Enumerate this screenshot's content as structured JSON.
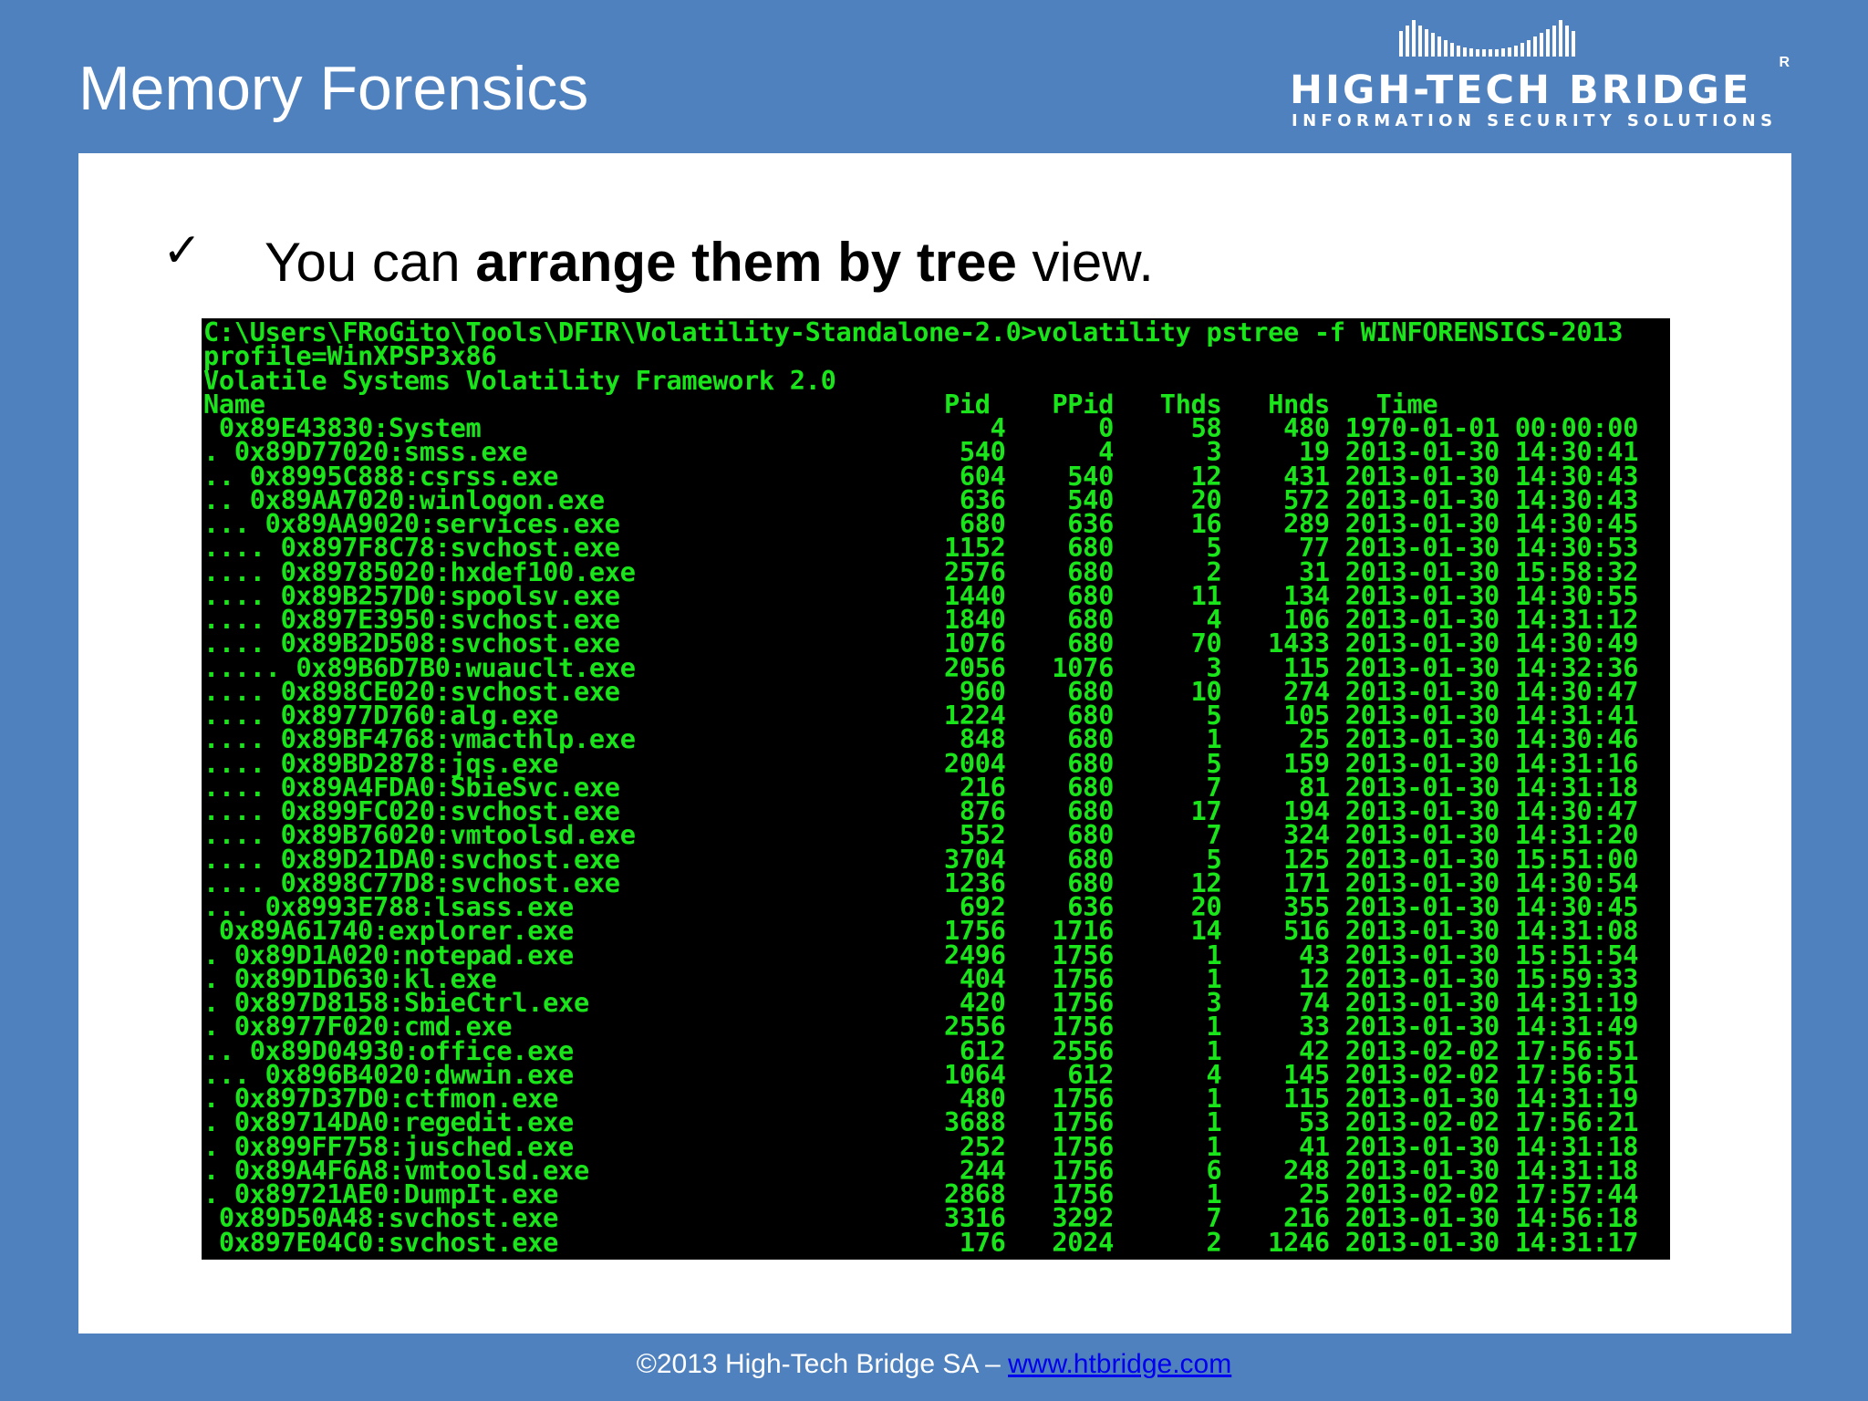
{
  "slide": {
    "title": "Memory Forensics",
    "bullet": {
      "check": "✓",
      "prefix": "You can ",
      "bold": "arrange them by tree",
      "suffix": " view."
    }
  },
  "logo": {
    "name": "HIGH-TECH BRIDGE",
    "registered": "R",
    "tagline": "INFORMATION SECURITY SOLUTIONS"
  },
  "terminal": {
    "command": [
      "C:\\Users\\FRoGito\\Tools\\DFIR\\Volatility-Standalone-2.0>volatility pstree -f WINFORENSICS-2013",
      "profile=WinXPSP3x86",
      "Volatile Systems Volatility Framework 2.0"
    ],
    "columns": [
      "Name",
      "Pid",
      "PPid",
      "Thds",
      "Hnds",
      "Time"
    ],
    "rows": [
      [
        "",
        "0x89E43830:System",
        "4",
        "0",
        "58",
        "480",
        "1970-01-01 00:00:00"
      ],
      [
        ".",
        "0x89D77020:smss.exe",
        "540",
        "4",
        "3",
        "19",
        "2013-01-30 14:30:41"
      ],
      [
        "..",
        "0x8995C888:csrss.exe",
        "604",
        "540",
        "12",
        "431",
        "2013-01-30 14:30:43"
      ],
      [
        "..",
        "0x89AA7020:winlogon.exe",
        "636",
        "540",
        "20",
        "572",
        "2013-01-30 14:30:43"
      ],
      [
        "...",
        "0x89AA9020:services.exe",
        "680",
        "636",
        "16",
        "289",
        "2013-01-30 14:30:45"
      ],
      [
        "....",
        "0x897F8C78:svchost.exe",
        "1152",
        "680",
        "5",
        "77",
        "2013-01-30 14:30:53"
      ],
      [
        "....",
        "0x89785020:hxdef100.exe",
        "2576",
        "680",
        "2",
        "31",
        "2013-01-30 15:58:32"
      ],
      [
        "....",
        "0x89B257D0:spoolsv.exe",
        "1440",
        "680",
        "11",
        "134",
        "2013-01-30 14:30:55"
      ],
      [
        "....",
        "0x897E3950:svchost.exe",
        "1840",
        "680",
        "4",
        "106",
        "2013-01-30 14:31:12"
      ],
      [
        "....",
        "0x89B2D508:svchost.exe",
        "1076",
        "680",
        "70",
        "1433",
        "2013-01-30 14:30:49"
      ],
      [
        ".....",
        "0x89B6D7B0:wuauclt.exe",
        "2056",
        "1076",
        "3",
        "115",
        "2013-01-30 14:32:36"
      ],
      [
        "....",
        "0x898CE020:svchost.exe",
        "960",
        "680",
        "10",
        "274",
        "2013-01-30 14:30:47"
      ],
      [
        "....",
        "0x8977D760:alg.exe",
        "1224",
        "680",
        "5",
        "105",
        "2013-01-30 14:31:41"
      ],
      [
        "....",
        "0x89BF4768:vmacthlp.exe",
        "848",
        "680",
        "1",
        "25",
        "2013-01-30 14:30:46"
      ],
      [
        "....",
        "0x89BD2878:jqs.exe",
        "2004",
        "680",
        "5",
        "159",
        "2013-01-30 14:31:16"
      ],
      [
        "....",
        "0x89A4FDA0:SbieSvc.exe",
        "216",
        "680",
        "7",
        "81",
        "2013-01-30 14:31:18"
      ],
      [
        "....",
        "0x899FC020:svchost.exe",
        "876",
        "680",
        "17",
        "194",
        "2013-01-30 14:30:47"
      ],
      [
        "....",
        "0x89B76020:vmtoolsd.exe",
        "552",
        "680",
        "7",
        "324",
        "2013-01-30 14:31:20"
      ],
      [
        "....",
        "0x89D21DA0:svchost.exe",
        "3704",
        "680",
        "5",
        "125",
        "2013-01-30 15:51:00"
      ],
      [
        "....",
        "0x898C77D8:svchost.exe",
        "1236",
        "680",
        "12",
        "171",
        "2013-01-30 14:30:54"
      ],
      [
        "...",
        "0x8993E788:lsass.exe",
        "692",
        "636",
        "20",
        "355",
        "2013-01-30 14:30:45"
      ],
      [
        "",
        "0x89A61740:explorer.exe",
        "1756",
        "1716",
        "14",
        "516",
        "2013-01-30 14:31:08"
      ],
      [
        ".",
        "0x89D1A020:notepad.exe",
        "2496",
        "1756",
        "1",
        "43",
        "2013-01-30 15:51:54"
      ],
      [
        ".",
        "0x89D1D630:kl.exe",
        "404",
        "1756",
        "1",
        "12",
        "2013-01-30 15:59:33"
      ],
      [
        ".",
        "0x897D8158:SbieCtrl.exe",
        "420",
        "1756",
        "3",
        "74",
        "2013-01-30 14:31:19"
      ],
      [
        ".",
        "0x8977F020:cmd.exe",
        "2556",
        "1756",
        "1",
        "33",
        "2013-01-30 14:31:49"
      ],
      [
        "..",
        "0x89D04930:office.exe",
        "612",
        "2556",
        "1",
        "42",
        "2013-02-02 17:56:51"
      ],
      [
        "...",
        "0x896B4020:dwwin.exe",
        "1064",
        "612",
        "4",
        "145",
        "2013-02-02 17:56:51"
      ],
      [
        ".",
        "0x897D37D0:ctfmon.exe",
        "480",
        "1756",
        "1",
        "115",
        "2013-01-30 14:31:19"
      ],
      [
        ".",
        "0x89714DA0:regedit.exe",
        "3688",
        "1756",
        "1",
        "53",
        "2013-02-02 17:56:21"
      ],
      [
        ".",
        "0x899FF758:jusched.exe",
        "252",
        "1756",
        "1",
        "41",
        "2013-01-30 14:31:18"
      ],
      [
        ".",
        "0x89A4F6A8:vmtoolsd.exe",
        "244",
        "1756",
        "6",
        "248",
        "2013-01-30 14:31:18"
      ],
      [
        ".",
        "0x89721AE0:DumpIt.exe",
        "2868",
        "1756",
        "1",
        "25",
        "2013-02-02 17:57:44"
      ],
      [
        "",
        "0x89D50A48:svchost.exe",
        "3316",
        "3292",
        "7",
        "216",
        "2013-01-30 14:56:18"
      ],
      [
        "",
        "0x897E04C0:svchost.exe",
        "176",
        "2024",
        "2",
        "1246",
        "2013-01-30 14:31:17"
      ]
    ]
  },
  "footer": {
    "text": "©2013 High-Tech Bridge SA – ",
    "link": "www.htbridge.com"
  }
}
